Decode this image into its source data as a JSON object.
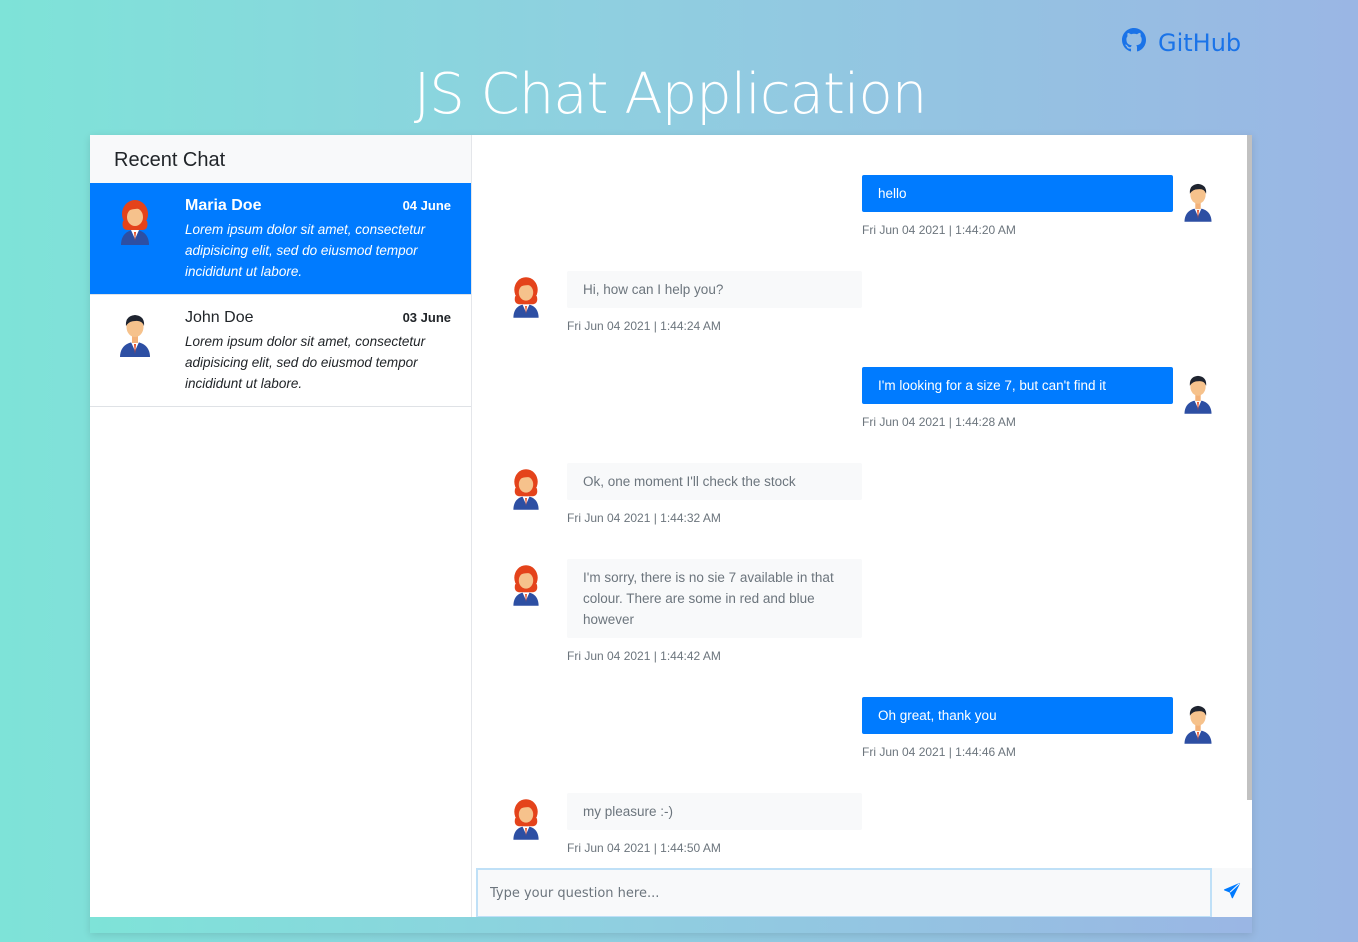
{
  "header": {
    "github_label": "GitHub",
    "title": "JS Chat Application"
  },
  "sidebar": {
    "title": "Recent Chat",
    "conversations": [
      {
        "name": "Maria Doe",
        "date": "04 June",
        "snippet": "Lorem ipsum dolor sit amet, consectetur adipisicing elit, sed do eiusmod tempor incididunt ut labore.",
        "active": true
      },
      {
        "name": "John Doe",
        "date": "03 June",
        "snippet": "Lorem ipsum dolor sit amet, consectetur adipisicing elit, sed do eiusmod tempor incididunt ut labore.",
        "active": false
      }
    ]
  },
  "messages": [
    {
      "direction": "out",
      "text": "hello",
      "time": "Fri Jun 04 2021 | 1:44:20 AM"
    },
    {
      "direction": "in",
      "text": "Hi, how can I help you?",
      "time": "Fri Jun 04 2021 | 1:44:24 AM"
    },
    {
      "direction": "out",
      "text": "I'm looking for a size 7, but can't find it",
      "time": "Fri Jun 04 2021 | 1:44:28 AM"
    },
    {
      "direction": "in",
      "text": "Ok, one moment I'll check the stock",
      "time": "Fri Jun 04 2021 | 1:44:32 AM"
    },
    {
      "direction": "in",
      "text": "I'm sorry, there is no sie 7 available in that colour. There are some in red and blue however",
      "time": "Fri Jun 04 2021 | 1:44:42 AM"
    },
    {
      "direction": "out",
      "text": "Oh great, thank you",
      "time": "Fri Jun 04 2021 | 1:44:46 AM"
    },
    {
      "direction": "in",
      "text": "my pleasure :-)",
      "time": "Fri Jun 04 2021 | 1:44:50 AM"
    }
  ],
  "composer": {
    "placeholder": "Type your question here..."
  },
  "icons": {
    "github": "github-icon",
    "send": "send-icon",
    "female_avatar": "female-avatar-icon",
    "male_avatar": "male-avatar-icon"
  },
  "colors": {
    "accent": "#007bff",
    "incoming_bubble": "#f8f9fa",
    "gradient_left": "#7ee3d8",
    "gradient_right": "#9ab6e4"
  }
}
